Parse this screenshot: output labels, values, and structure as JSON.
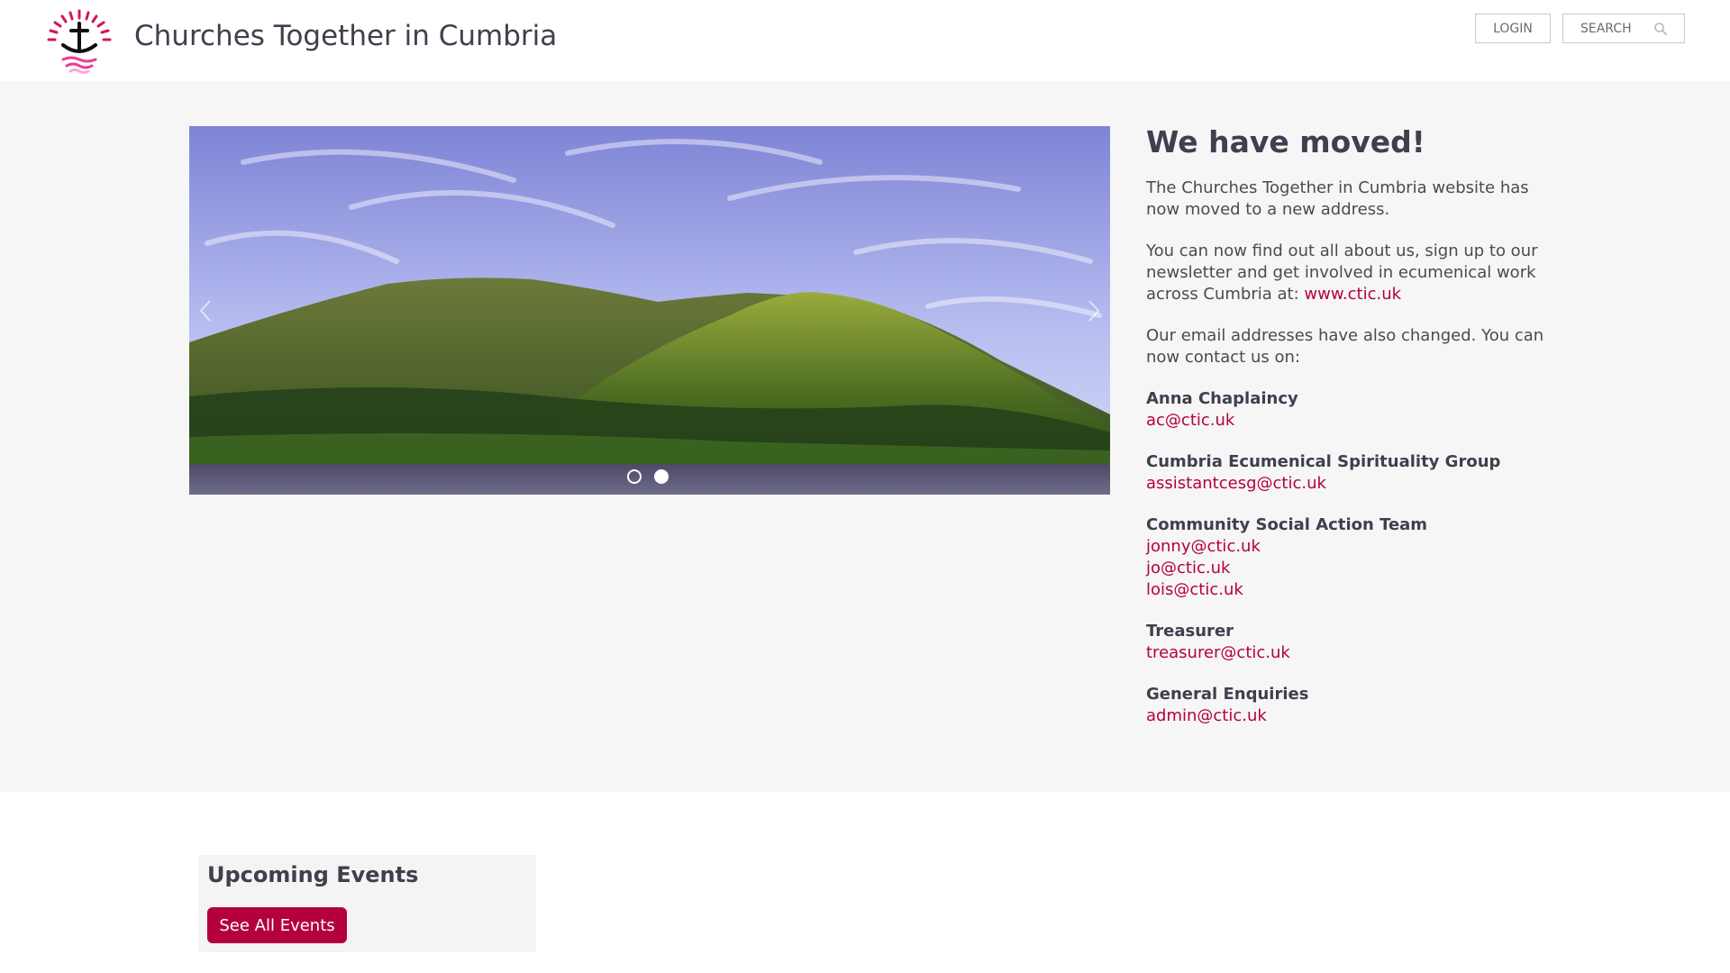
{
  "header": {
    "site_title": "Churches Together in Cumbria",
    "login_label": "LOGIN",
    "search_placeholder": "SEARCH"
  },
  "carousel": {
    "slide_count": 2,
    "active_slide": 2
  },
  "notice": {
    "heading": "We have moved!",
    "para1": "The Churches Together in Cumbria website has now moved to a new address.",
    "para2_text": "You can now find out all about us, sign up to our newsletter and get involved in ecumenical work across Cumbria at: ",
    "para2_link": "www.ctic.uk",
    "para3": "Our email addresses have also changed. You can now contact us on:",
    "contacts": [
      {
        "name": "Anna Chaplaincy",
        "emails": [
          "ac@ctic.uk"
        ]
      },
      {
        "name": "Cumbria Ecumenical Spirituality Group",
        "emails": [
          "assistantcesg@ctic.uk"
        ]
      },
      {
        "name": "Community Social Action Team",
        "emails": [
          "jonny@ctic.uk",
          "jo@ctic.uk",
          "lois@ctic.uk"
        ]
      },
      {
        "name": "Treasurer",
        "emails": [
          "treasurer@ctic.uk"
        ]
      },
      {
        "name": "General Enquiries",
        "emails": [
          "admin@ctic.uk"
        ]
      }
    ]
  },
  "events": {
    "heading": "Upcoming Events",
    "button_label": "See All Events"
  },
  "colors": {
    "accent": "#b5003e",
    "heading": "#3f3f4e",
    "band_background": "#f6f6f6"
  }
}
